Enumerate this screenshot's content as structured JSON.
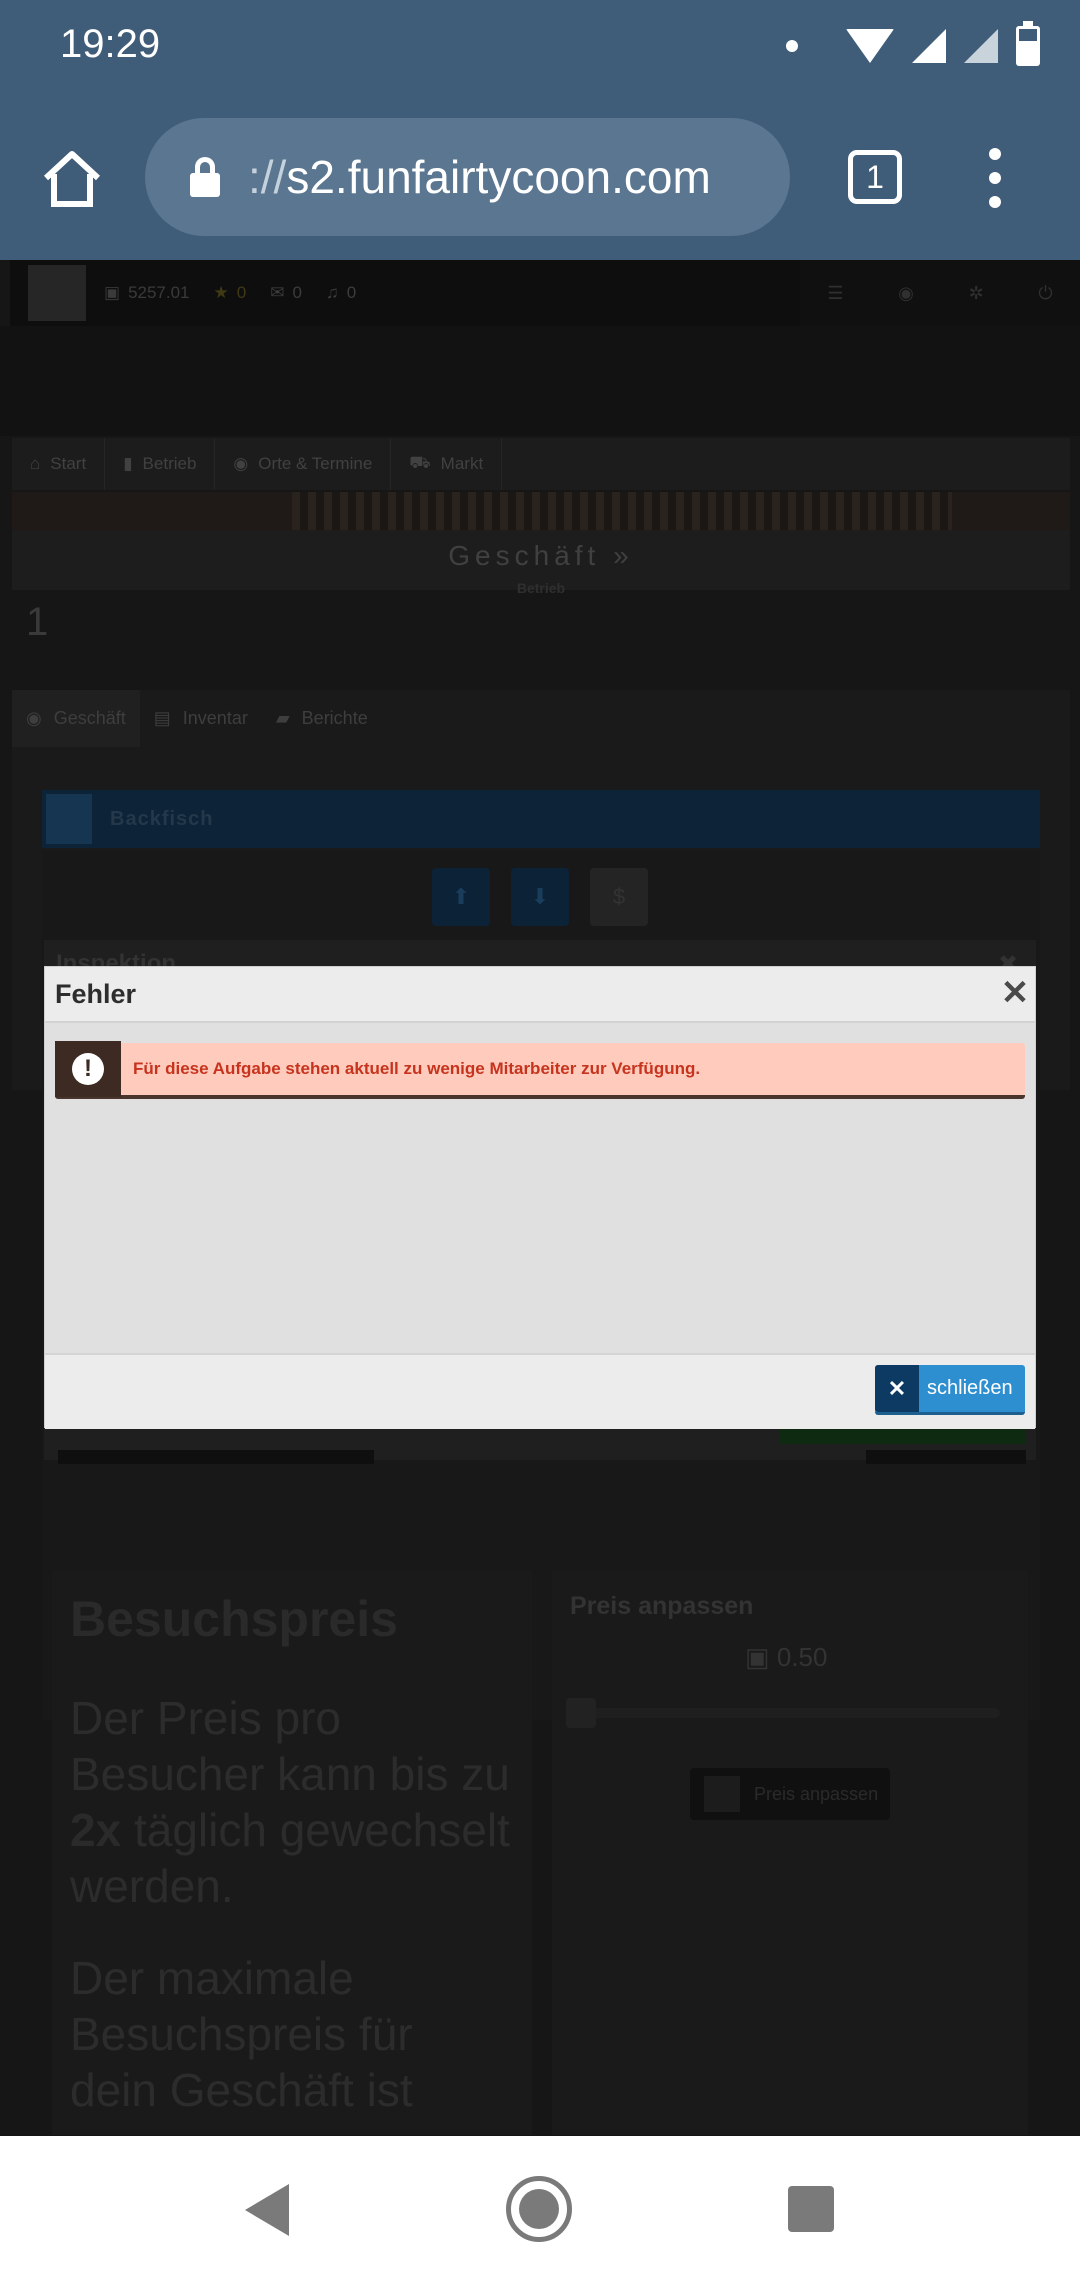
{
  "status_bar": {
    "time": "19:29"
  },
  "browser": {
    "url_scheme": "://",
    "url_host": "s2.funfairtycoon.com",
    "tab_count": "1"
  },
  "topbar": {
    "money": "5257.01",
    "stars": "0",
    "messages": "0",
    "notifications": "0"
  },
  "breadcrumb": [
    "Start",
    "Betrieb",
    "Orte & Termine",
    "Markt"
  ],
  "section": {
    "title": "Geschäft",
    "subtitle": "Betrieb",
    "number": "1"
  },
  "tabs": [
    "Geschäft",
    "Inventar",
    "Berichte"
  ],
  "panel": {
    "name": "Backfisch"
  },
  "inspection": {
    "title": "Inspektion"
  },
  "besuchspreis": {
    "heading": "Besuchspreis",
    "text1_a": "Der Preis pro Besucher kann bis zu ",
    "text1_b": "2x",
    "text1_c": " täglich gewechselt werden.",
    "text2": "Der maximale Besuchspreis für dein Geschäft ist"
  },
  "price": {
    "heading": "Preis anpassen",
    "value": "0.50",
    "button": "Preis anpassen"
  },
  "modal": {
    "title": "Fehler",
    "message": "Für diese Aufgabe stehen aktuell zu wenige Mitarbeiter zur Verfügung.",
    "close_label": "schließen"
  },
  "colors": {
    "chrome": "#3f5d78",
    "alert_bg": "#ffcbbd",
    "alert_text": "#c6341e",
    "button": "#2e8fd0"
  }
}
